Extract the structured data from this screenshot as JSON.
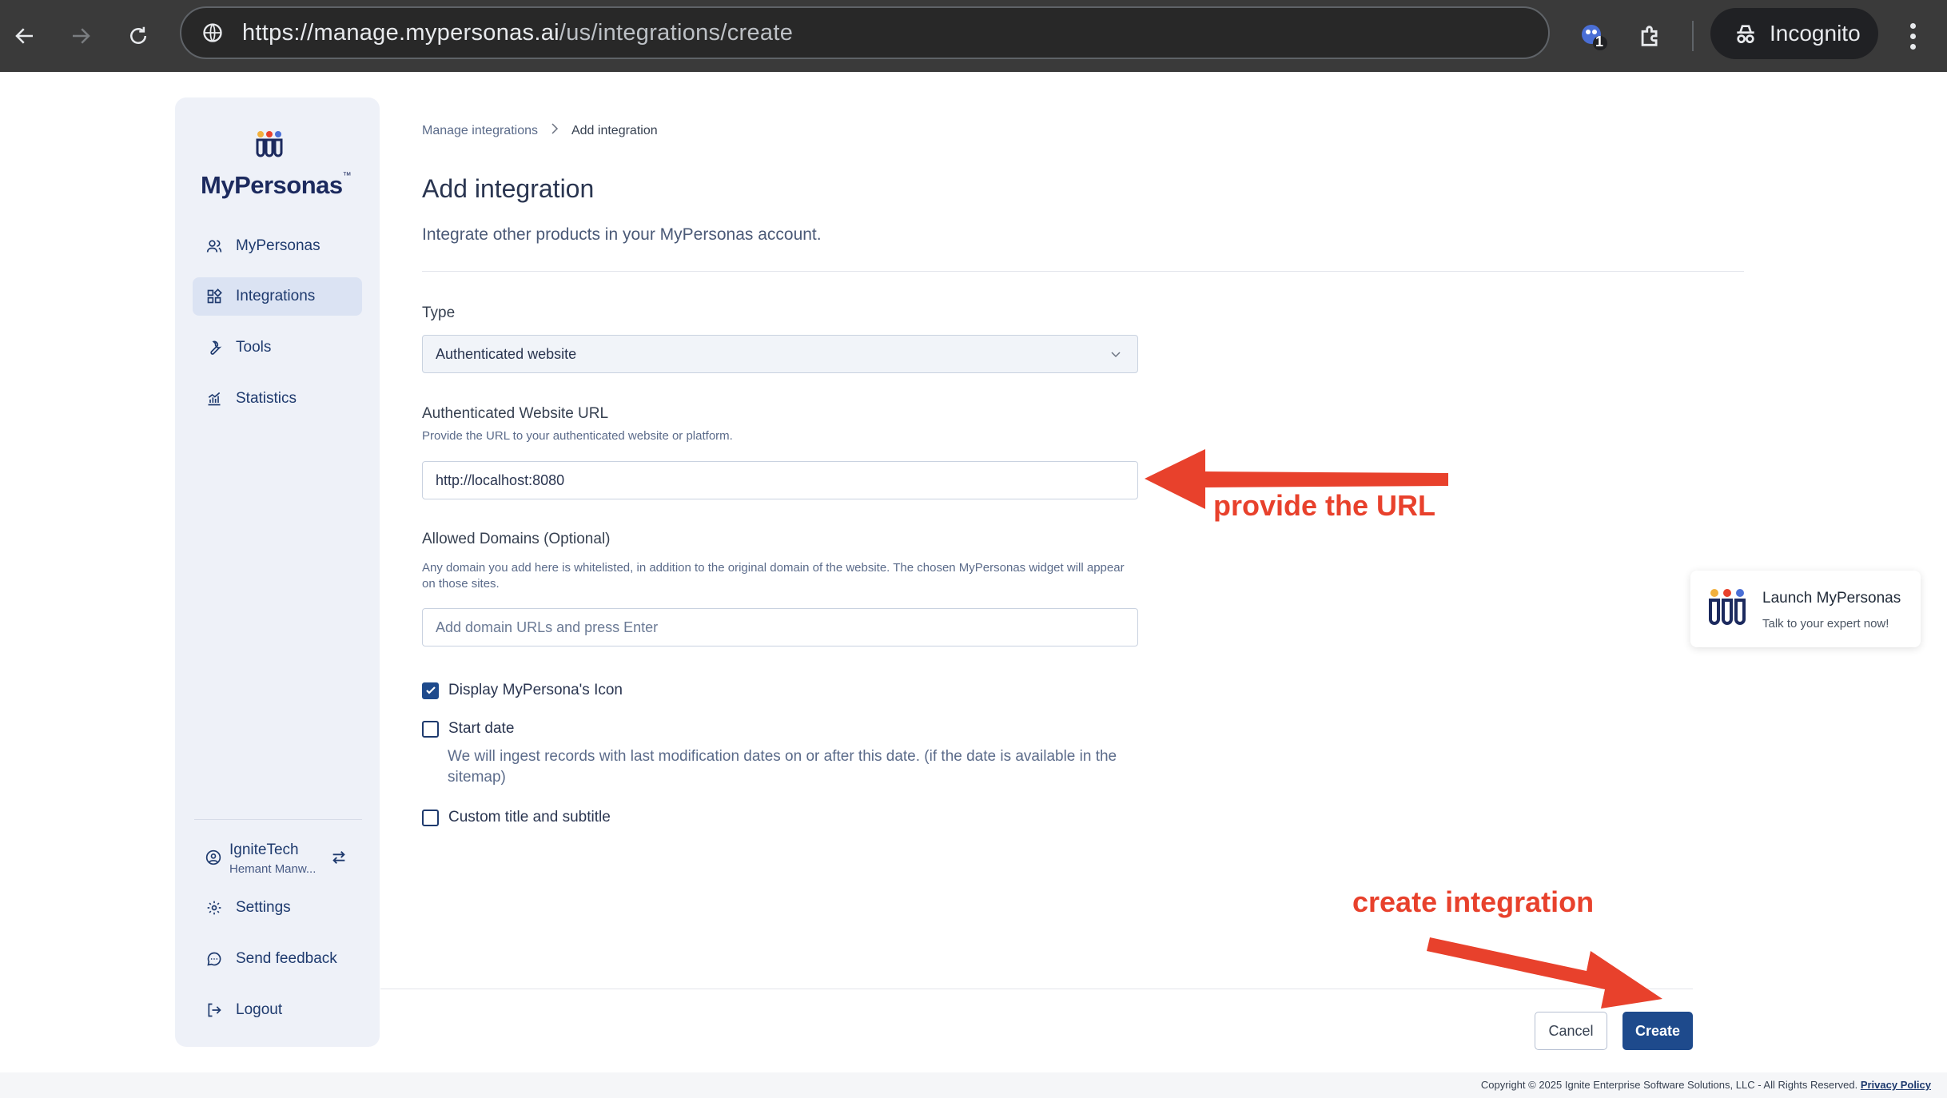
{
  "browser": {
    "url_host": "https://manage.mypersonas.ai",
    "url_path": "/us/integrations/create",
    "extension_badge": "1",
    "incognito_label": "Incognito"
  },
  "sidebar": {
    "logo_text": "MyPersonas",
    "logo_tm": "™",
    "items": [
      {
        "label": "MyPersonas",
        "icon": "users-icon"
      },
      {
        "label": "Integrations",
        "icon": "integrations-icon",
        "active": true
      },
      {
        "label": "Tools",
        "icon": "wrench-icon"
      },
      {
        "label": "Statistics",
        "icon": "chart-icon"
      }
    ],
    "org": {
      "name": "IgniteTech",
      "user": "Hemant Manw..."
    },
    "bottom_items": [
      {
        "label": "Settings",
        "icon": "gear-icon"
      },
      {
        "label": "Send feedback",
        "icon": "feedback-icon"
      },
      {
        "label": "Logout",
        "icon": "logout-icon"
      }
    ]
  },
  "breadcrumb": {
    "parent": "Manage integrations",
    "current": "Add integration"
  },
  "page": {
    "title": "Add integration",
    "subtitle": "Integrate other products in your MyPersonas account."
  },
  "form": {
    "type_label": "Type",
    "type_value": "Authenticated website",
    "url_label": "Authenticated Website URL",
    "url_hint": "Provide the URL to your authenticated website or platform.",
    "url_value": "http://localhost:8080",
    "domains_label": "Allowed Domains (Optional)",
    "domains_hint": "Any domain you add here is whitelisted, in addition to the original domain of the website. The chosen MyPersonas widget will appear on those sites.",
    "domains_placeholder": "Add domain URLs and press Enter",
    "display_icon_label": "Display MyPersona's Icon",
    "display_icon_checked": true,
    "start_date_label": "Start date",
    "start_date_checked": false,
    "start_date_desc": "We will ingest records with last modification dates on or after this date. (if the date is available in the sitemap)",
    "custom_title_label": "Custom title and subtitle",
    "custom_title_checked": false
  },
  "actions": {
    "cancel": "Cancel",
    "create": "Create"
  },
  "widget": {
    "title": "Launch MyPersonas",
    "subtitle": "Talk to your expert now!"
  },
  "footer": {
    "copyright": "Copyright © 2025 Ignite Enterprise Software Solutions, LLC - All Rights Reserved.",
    "privacy": "Privacy Policy"
  },
  "annotations": {
    "url_note": "provide the URL",
    "create_note": "create integration",
    "color": "#e8412c"
  },
  "colors": {
    "primary": "#1e4a8c",
    "sidebar_bg": "#eef1f8",
    "active_item_bg": "#dbe3f3"
  }
}
